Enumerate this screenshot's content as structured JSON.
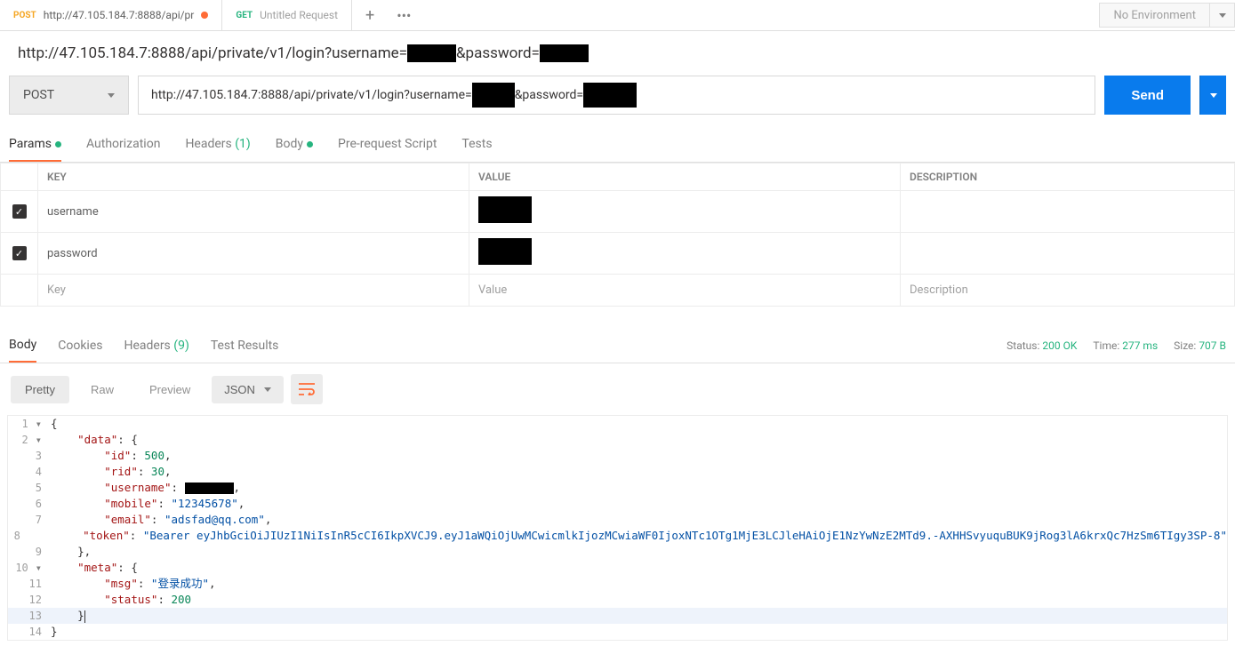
{
  "tabs": [
    {
      "method": "POST",
      "methodClass": "post",
      "title": "http://47.105.184.7:8888/api/pr",
      "dirty": true
    },
    {
      "method": "GET",
      "methodClass": "get",
      "title": "Untitled Request",
      "dirty": false
    }
  ],
  "environment": {
    "label": "No Environment"
  },
  "breadcrumb": {
    "prefix": "http://47.105.184.7:8888/api/private/v1/login?username=",
    "mid": "&password="
  },
  "request": {
    "method": "POST",
    "url_prefix": "http://47.105.184.7:8888/api/private/v1/login?username=",
    "url_mid": "&password=",
    "send_label": "Send"
  },
  "subtabs": [
    {
      "label": "Params",
      "indicator": "dot",
      "active": true
    },
    {
      "label": "Authorization"
    },
    {
      "label": "Headers",
      "count": "(1)"
    },
    {
      "label": "Body",
      "indicator": "dot"
    },
    {
      "label": "Pre-request Script"
    },
    {
      "label": "Tests"
    }
  ],
  "params_headers": {
    "key": "KEY",
    "value": "VALUE",
    "desc": "DESCRIPTION"
  },
  "params_rows": [
    {
      "checked": true,
      "key": "username",
      "redacted": true
    },
    {
      "checked": true,
      "key": "password",
      "redacted": true
    }
  ],
  "params_placeholder": {
    "key": "Key",
    "value": "Value",
    "desc": "Description"
  },
  "response_tabs": [
    {
      "label": "Body",
      "active": true
    },
    {
      "label": "Cookies"
    },
    {
      "label": "Headers",
      "count": "(9)"
    },
    {
      "label": "Test Results"
    }
  ],
  "response_meta": {
    "status_label": "Status:",
    "status_value": "200 OK",
    "time_label": "Time:",
    "time_value": "277 ms",
    "size_label": "Size:",
    "size_value": "707 B"
  },
  "format_bar": {
    "pretty": "Pretty",
    "raw": "Raw",
    "preview": "Preview",
    "type": "JSON"
  },
  "response_body": {
    "data": {
      "id": 500,
      "rid": 30,
      "username_redacted": true,
      "mobile": "12345678",
      "email": "adsfad@qq.com",
      "token": "Bearer eyJhbGciOiJIUzI1NiIsInR5cCI6IkpXVCJ9.eyJ1aWQiOjUwMCwicmlkIjozMCwiaWF0IjoxNTc1OTg1MjE3LCJleHAiOjE1NzYwNzE2MTd9.-AXHHSvyuquBUK9jRog3lA6krxQc7HzSm6TIgy3SP-8"
    },
    "meta": {
      "msg": "登录成功",
      "status": 200
    }
  }
}
